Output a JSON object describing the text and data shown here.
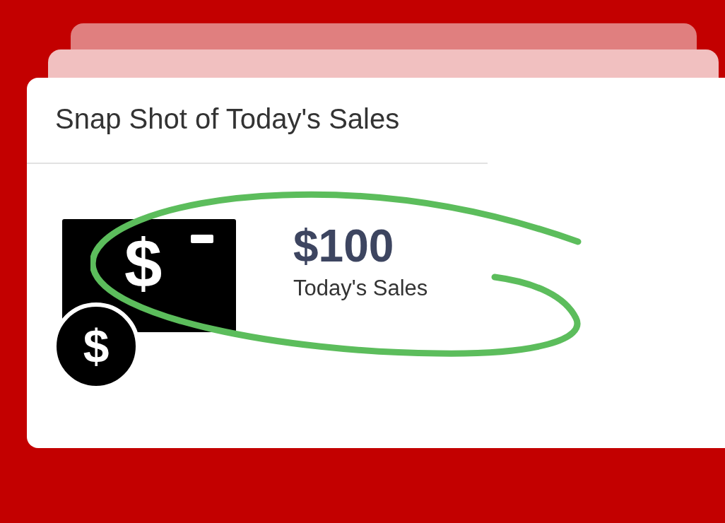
{
  "card": {
    "title": "Snap Shot of Today's Sales",
    "amount": "$100",
    "caption": "Today's Sales",
    "icon_symbols": [
      "$",
      "$"
    ]
  }
}
